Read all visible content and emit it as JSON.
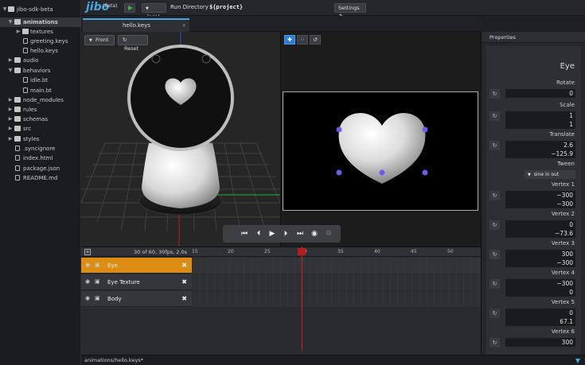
{
  "app": {
    "logo": "jibo",
    "beta": "(Beta)",
    "target": "local",
    "run_directory_label": "Run Directory",
    "run_directory_value": "${project}",
    "settings_label": "Settings"
  },
  "sidebar": {
    "items": [
      {
        "label": "jibo-sdk-beta",
        "type": "folder",
        "expanded": true
      },
      {
        "label": "animations",
        "type": "folder",
        "expanded": true,
        "selected": true
      },
      {
        "label": "textures",
        "type": "folder",
        "expanded": false
      },
      {
        "label": "greeting.keys",
        "type": "file"
      },
      {
        "label": "hello.keys",
        "type": "file"
      },
      {
        "label": "audio",
        "type": "folder",
        "expanded": false
      },
      {
        "label": "behaviors",
        "type": "folder",
        "expanded": true
      },
      {
        "label": "idle.bt",
        "type": "file"
      },
      {
        "label": "main.bt",
        "type": "file"
      },
      {
        "label": "node_modules",
        "type": "folder",
        "expanded": false
      },
      {
        "label": "rules",
        "type": "folder",
        "expanded": false
      },
      {
        "label": "schemas",
        "type": "folder",
        "expanded": false
      },
      {
        "label": "src",
        "type": "folder",
        "expanded": false
      },
      {
        "label": "styles",
        "type": "folder",
        "expanded": false
      },
      {
        "label": ".syncignore",
        "type": "file"
      },
      {
        "label": "index.html",
        "type": "file"
      },
      {
        "label": "package.json",
        "type": "file"
      },
      {
        "label": "README.md",
        "type": "file"
      }
    ]
  },
  "editor": {
    "tab_label": "hello.keys",
    "tab_close": "×"
  },
  "viewport": {
    "front_label": "Front",
    "reset_label": "Reset"
  },
  "face_tools": {
    "move": "✚",
    "points": "⁘",
    "rotate": "↺"
  },
  "properties": {
    "header": "Properties",
    "title": "Eye",
    "rotate_label": "Rotate",
    "rotate_value": "0",
    "scale_label": "Scale",
    "scale_x": "1",
    "scale_y": "1",
    "translate_label": "Translate",
    "translate_x": "2.6",
    "translate_y": "−125.9",
    "tween_label": "Tween",
    "tween_value": "sine in out",
    "vertices": [
      {
        "label": "Vertex 1",
        "x": "−300",
        "y": "−300"
      },
      {
        "label": "Vertex 2",
        "x": "0",
        "y": "−73.6"
      },
      {
        "label": "Vertex 3",
        "x": "300",
        "y": "−300"
      },
      {
        "label": "Vertex 4",
        "x": "−300",
        "y": "0"
      },
      {
        "label": "Vertex 5",
        "x": "0",
        "y": "67.1"
      },
      {
        "label": "Vertex 6",
        "x": "300",
        "y": ""
      }
    ]
  },
  "timeline": {
    "info": "30 of 60, 30fps, 2.0s",
    "ticks": [
      "15",
      "20",
      "25",
      "30",
      "35",
      "40",
      "45",
      "50"
    ],
    "current_frame": 30,
    "layers": [
      {
        "name": "Eye",
        "active": true
      },
      {
        "name": "Eye Texture",
        "active": false
      },
      {
        "name": "Body",
        "active": false
      }
    ]
  },
  "status": {
    "path": "animations/hello.keys*"
  },
  "colors": {
    "accent": "#4aa6e0",
    "active_layer": "#dd8d13",
    "playhead": "#d62020",
    "play_green": "#3bb34a"
  }
}
